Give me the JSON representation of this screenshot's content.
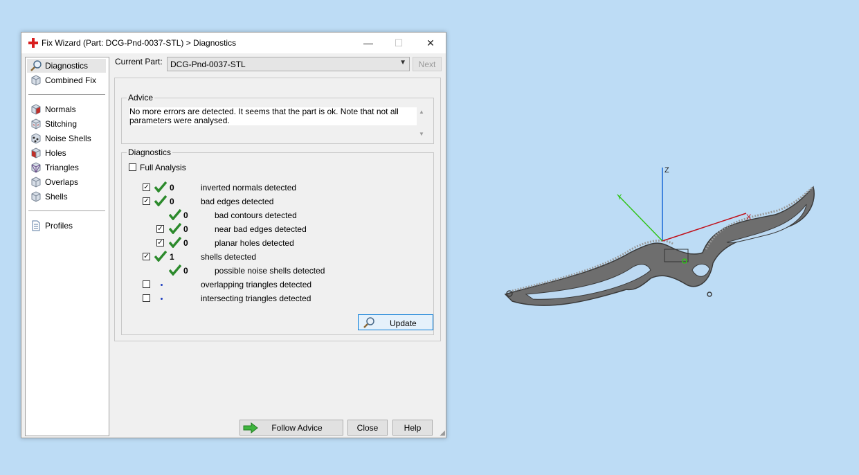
{
  "window": {
    "title": "Fix Wizard (Part: DCG-Pnd-0037-STL) > Diagnostics",
    "minimize": "—",
    "maximize": "☐",
    "close": "✕"
  },
  "sidebar": {
    "items": [
      {
        "label": "Diagnostics",
        "icon": "magnifier-icon"
      },
      {
        "label": "Combined Fix",
        "icon": "cube-icon"
      },
      {
        "label": "Normals",
        "icon": "normals-cube-icon"
      },
      {
        "label": "Stitching",
        "icon": "stitching-cube-icon"
      },
      {
        "label": "Noise Shells",
        "icon": "noise-shells-icon"
      },
      {
        "label": "Holes",
        "icon": "holes-cube-icon"
      },
      {
        "label": "Triangles",
        "icon": "triangles-cube-icon"
      },
      {
        "label": "Overlaps",
        "icon": "overlaps-cube-icon"
      },
      {
        "label": "Shells",
        "icon": "shells-cube-icon"
      },
      {
        "label": "Profiles",
        "icon": "document-icon"
      }
    ]
  },
  "current_part": {
    "label": "Current Part:",
    "value": "DCG-Pnd-0037-STL",
    "next_label": "Next"
  },
  "advice": {
    "title": "Advice",
    "text": "No more errors are detected. It seems that the part is ok. Note that not all parameters were analysed."
  },
  "diagnostics": {
    "title": "Diagnostics",
    "full_analysis_label": "Full Analysis",
    "rows": [
      {
        "checkbox": true,
        "checked": true,
        "status": "ok",
        "count": "0",
        "label": "inverted normals detected",
        "indent": 0
      },
      {
        "checkbox": true,
        "checked": true,
        "status": "ok",
        "count": "0",
        "label": "bad edges detected",
        "indent": 0
      },
      {
        "checkbox": false,
        "checked": false,
        "status": "ok",
        "count": "0",
        "label": "bad contours detected",
        "indent": 1
      },
      {
        "checkbox": true,
        "checked": true,
        "status": "ok",
        "count": "0",
        "label": "near bad edges detected",
        "indent": 1
      },
      {
        "checkbox": true,
        "checked": true,
        "status": "ok",
        "count": "0",
        "label": "planar holes detected",
        "indent": 1
      },
      {
        "checkbox": true,
        "checked": true,
        "status": "ok",
        "count": "1",
        "label": "shells detected",
        "indent": 0
      },
      {
        "checkbox": false,
        "checked": false,
        "status": "ok",
        "count": "0",
        "label": "possible noise shells detected",
        "indent": 1
      },
      {
        "checkbox": true,
        "checked": false,
        "status": "pending",
        "count": "",
        "label": "overlapping triangles detected",
        "indent": 0
      },
      {
        "checkbox": true,
        "checked": false,
        "status": "pending",
        "count": "",
        "label": "intersecting triangles detected",
        "indent": 0
      }
    ],
    "update_label": "Update"
  },
  "footer": {
    "follow_advice_label": "Follow Advice",
    "close_label": "Close",
    "help_label": "Help"
  },
  "viewport": {
    "axis_labels": {
      "x": "X",
      "y": "Y",
      "z": "Z"
    },
    "colors": {
      "x_axis": "#c0101a",
      "y_axis": "#2fc417",
      "z_axis": "#1766d6",
      "background": "#bddcf5"
    }
  }
}
